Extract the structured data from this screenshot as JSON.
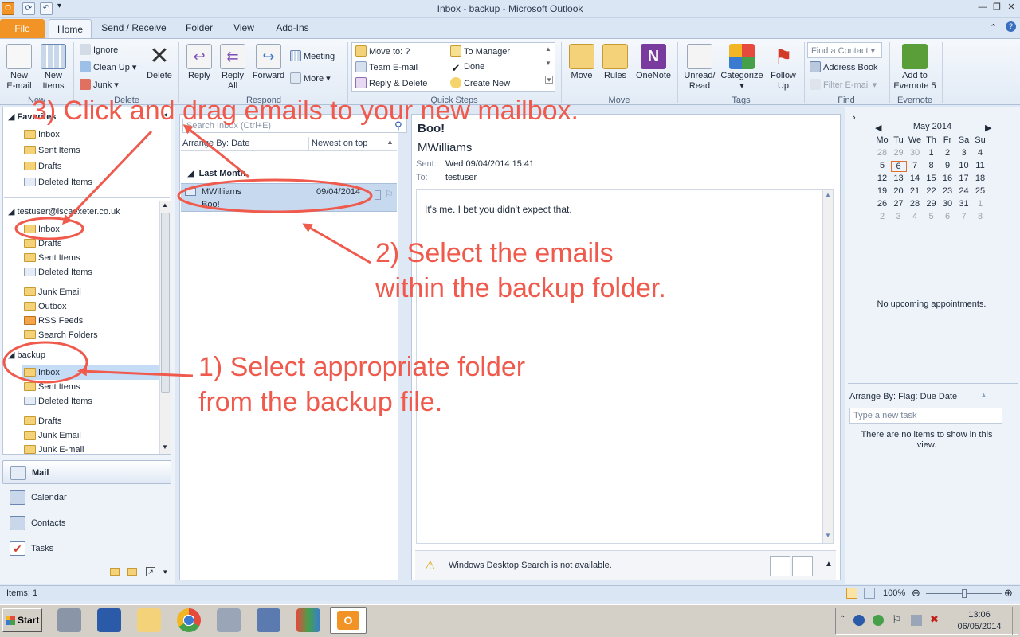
{
  "window": {
    "title": "Inbox - backup - Microsoft Outlook"
  },
  "tabs": [
    {
      "label": "File"
    },
    {
      "label": "Home"
    },
    {
      "label": "Send / Receive"
    },
    {
      "label": "Folder"
    },
    {
      "label": "View"
    },
    {
      "label": "Add-Ins"
    }
  ],
  "ribbon": {
    "new_email": "New\nE-mail",
    "new_items": "New\nItems",
    "ignore": "Ignore",
    "clean_up": "Clean Up",
    "junk": "Junk",
    "delete": "Delete",
    "reply": "Reply",
    "reply_all": "Reply\nAll",
    "forward": "Forward",
    "meeting": "Meeting",
    "more": "More",
    "qs_move_to": "Move to: ?",
    "qs_team_email": "Team E-mail",
    "qs_reply_delete": "Reply & Delete",
    "qs_to_manager": "To Manager",
    "qs_done": "Done",
    "qs_create_new": "Create New",
    "move": "Move",
    "rules": "Rules",
    "onenote": "OneNote",
    "unread_read": "Unread/\nRead",
    "categorize": "Categorize",
    "follow_up": "Follow\nUp",
    "find_contact_placeholder": "Find a Contact",
    "address_book": "Address Book",
    "filter_email": "Filter E-mail",
    "add_to_evernote": "Add to\nEvernote 5",
    "groups": {
      "new": "New",
      "delete": "Delete",
      "respond": "Respond",
      "quick_steps": "Quick Steps",
      "move": "Move",
      "tags": "Tags",
      "find": "Find",
      "evernote": "Evernote"
    }
  },
  "nav": {
    "favorites": {
      "header": "Favorites",
      "items": [
        "Inbox",
        "Sent Items",
        "Drafts",
        "Deleted Items"
      ]
    },
    "account": {
      "header": "testuser@iscaexeter.co.uk",
      "items": [
        "Inbox",
        "Drafts",
        "Sent Items",
        "Deleted Items",
        "Junk Email",
        "Outbox",
        "RSS Feeds",
        "Search Folders"
      ]
    },
    "backup": {
      "header": "backup",
      "items": [
        "Inbox",
        "Sent Items",
        "Deleted Items",
        "Drafts",
        "Junk Email",
        "Junk E-mail"
      ]
    },
    "modules": [
      "Mail",
      "Calendar",
      "Contacts",
      "Tasks"
    ]
  },
  "list": {
    "search_placeholder": "Search Inbox (Ctrl+E)",
    "arrange_by": "Arrange By: Date",
    "sort_order": "Newest on top",
    "group": "Last Month",
    "messages": [
      {
        "sender": "MWilliams",
        "date": "09/04/2014",
        "subject": "Boo!"
      }
    ]
  },
  "reading": {
    "subject": "Boo!",
    "from": "MWilliams",
    "sent_label": "Sent:",
    "sent_value": "Wed 09/04/2014 15:41",
    "to_label": "To:",
    "to_value": "testuser",
    "body": "It's me. I bet you didn't expect that.",
    "search_warning": "Windows Desktop Search is not available."
  },
  "todo": {
    "month": "May 2014",
    "weekdays": [
      "Mo",
      "Tu",
      "We",
      "Th",
      "Fr",
      "Sa",
      "Su"
    ],
    "weeks": [
      [
        "28",
        "29",
        "30",
        "1",
        "2",
        "3",
        "4"
      ],
      [
        "5",
        "6",
        "7",
        "8",
        "9",
        "10",
        "11"
      ],
      [
        "12",
        "13",
        "14",
        "15",
        "16",
        "17",
        "18"
      ],
      [
        "19",
        "20",
        "21",
        "22",
        "23",
        "24",
        "25"
      ],
      [
        "26",
        "27",
        "28",
        "29",
        "30",
        "31",
        "1"
      ],
      [
        "2",
        "3",
        "4",
        "5",
        "6",
        "7",
        "8"
      ]
    ],
    "no_appointments": "No upcoming appointments.",
    "tasks_arrange": "Arrange By: Flag: Due Date",
    "new_task_placeholder": "Type a new task",
    "no_items": "There are no items to show in this view."
  },
  "status": {
    "items": "Items: 1",
    "zoom": "100%"
  },
  "taskbar": {
    "start": "Start",
    "time": "13:06",
    "date": "06/05/2014"
  },
  "annotations": {
    "step1_line1": "1) Select appropriate folder",
    "step1_line2": "from the backup file.",
    "step2_line1": "2) Select the emails",
    "step2_line2": "within the backup folder.",
    "step3": "3) Click and drag emails to your new mailbox."
  },
  "colors": {
    "accent_red": "#ef5a4d",
    "file_tab": "#f29325",
    "selection": "#c4dcf6"
  }
}
